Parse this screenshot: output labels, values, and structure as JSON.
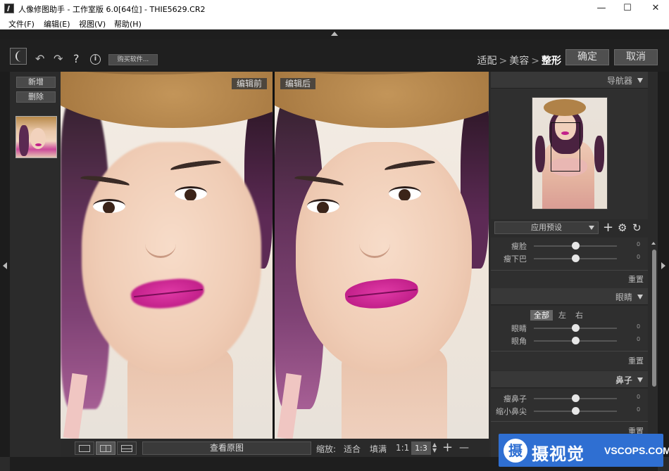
{
  "window": {
    "title": "人像修图助手 - 工作室版 6.0[64位] - THIE5629.CR2",
    "minimize": "—",
    "maximize": "☐",
    "close": "✕"
  },
  "menu": [
    "文件(F)",
    "编辑(E)",
    "视图(V)",
    "帮助(H)"
  ],
  "toolbar": {
    "undo": "↶",
    "redo": "↷",
    "help": "?",
    "info": "i",
    "buy": "购买软件...",
    "steps": [
      "适配",
      "美容",
      "整形"
    ],
    "step_sep": ">",
    "confirm": "确定",
    "cancel": "取消"
  },
  "left_panel": {
    "add": "新增",
    "delete": "删除"
  },
  "photos": {
    "before_label": "编辑前",
    "after_label": "编辑后"
  },
  "bottom_bar": {
    "view_original": "查看原图",
    "zoom": "缩放:",
    "fit": "适合",
    "fill": "填满",
    "one_to_one": "1:1",
    "ratio": "1:3",
    "plus": "+",
    "minus": "—"
  },
  "right_panel": {
    "navigator": "导航器",
    "preset": "应用预设",
    "preset_icons": {
      "add": "+",
      "settings": "⚙",
      "refresh": "↻"
    },
    "face_section": {
      "sliders": [
        {
          "label": "瘦脸",
          "value": "0"
        },
        {
          "label": "瘦下巴",
          "value": "0"
        }
      ],
      "reset": "重置"
    },
    "eyes_section": {
      "title": "眼睛",
      "tabs": [
        "全部",
        "左",
        "右"
      ],
      "sliders": [
        {
          "label": "眼睛",
          "value": "0"
        },
        {
          "label": "眼角",
          "value": "0"
        }
      ],
      "reset": "重置"
    },
    "nose_section": {
      "title": "鼻子",
      "sliders": [
        {
          "label": "瘦鼻子",
          "value": "0"
        },
        {
          "label": "缩小鼻尖",
          "value": "0"
        }
      ],
      "reset": "重置"
    }
  },
  "watermark": {
    "logo": "摄",
    "cn": "摄视觉",
    "en": "VSCOPS.COM"
  }
}
